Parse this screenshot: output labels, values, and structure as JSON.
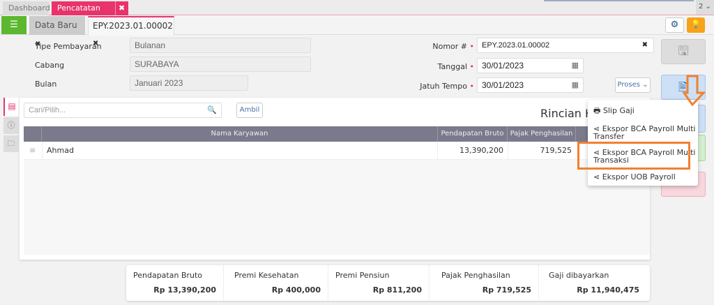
{
  "tabs": {
    "dashboard": "Dashboard",
    "active": "Pencatatan Gaji",
    "close": "✖",
    "counter": "2 ⌄"
  },
  "subtabs": {
    "new": "Data Baru",
    "current": "EPY.2023.01.00002",
    "close": "✖"
  },
  "form": {
    "tipe_label": "Tipe Pembayaran",
    "tipe_value": "Bulanan",
    "cabang_label": "Cabang",
    "cabang_value": "SURABAYA",
    "bulan_label": "Bulan",
    "bulan_value": "Januari 2023",
    "nomor_label": "Nomor #",
    "nomor_value": "EPY.2023.01.00002",
    "tanggal_label": "Tanggal",
    "tanggal_value": "30/01/2023",
    "jatuh_label": "Jatuh Tempo",
    "jatuh_value": "30/01/2023",
    "required": "•",
    "proses": "Proses ⌄"
  },
  "panel": {
    "search_placeholder": "Cari/Pilih...",
    "ambil": "Ambil",
    "title": "Rincian Ka",
    "columns": [
      "Nama Karyawan",
      "Pendapatan Bruto",
      "Pajak Penghasilan"
    ],
    "rows": [
      {
        "name": "Ahmad",
        "bruto": "13,390,200",
        "pajak": "719,525"
      }
    ]
  },
  "menu": {
    "items": [
      "Slip Gaji",
      "Ekspor BCA Payroll Multi Transfer",
      "Ekspor BCA Payroll Multi Transaksi",
      "Ekspor UOB Payroll"
    ],
    "highlighted": "Ekspor BCA Payroll Multi Transaksi"
  },
  "summary": [
    {
      "label": "Pendapatan Bruto",
      "value": "Rp 13,390,200"
    },
    {
      "label": "Premi Kesehatan",
      "value": "Rp 400,000"
    },
    {
      "label": "Premi Pensiun",
      "value": "Rp 811,200"
    },
    {
      "label": "Pajak Penghasilan",
      "value": "Rp 719,525"
    },
    {
      "label": "Gaji dibayarkan",
      "value": "Rp 11,940,475"
    }
  ],
  "colors": {
    "accent": "#e8336b",
    "highlight": "#f08030",
    "green": "#5cb82e",
    "orange": "#f7a21b"
  }
}
